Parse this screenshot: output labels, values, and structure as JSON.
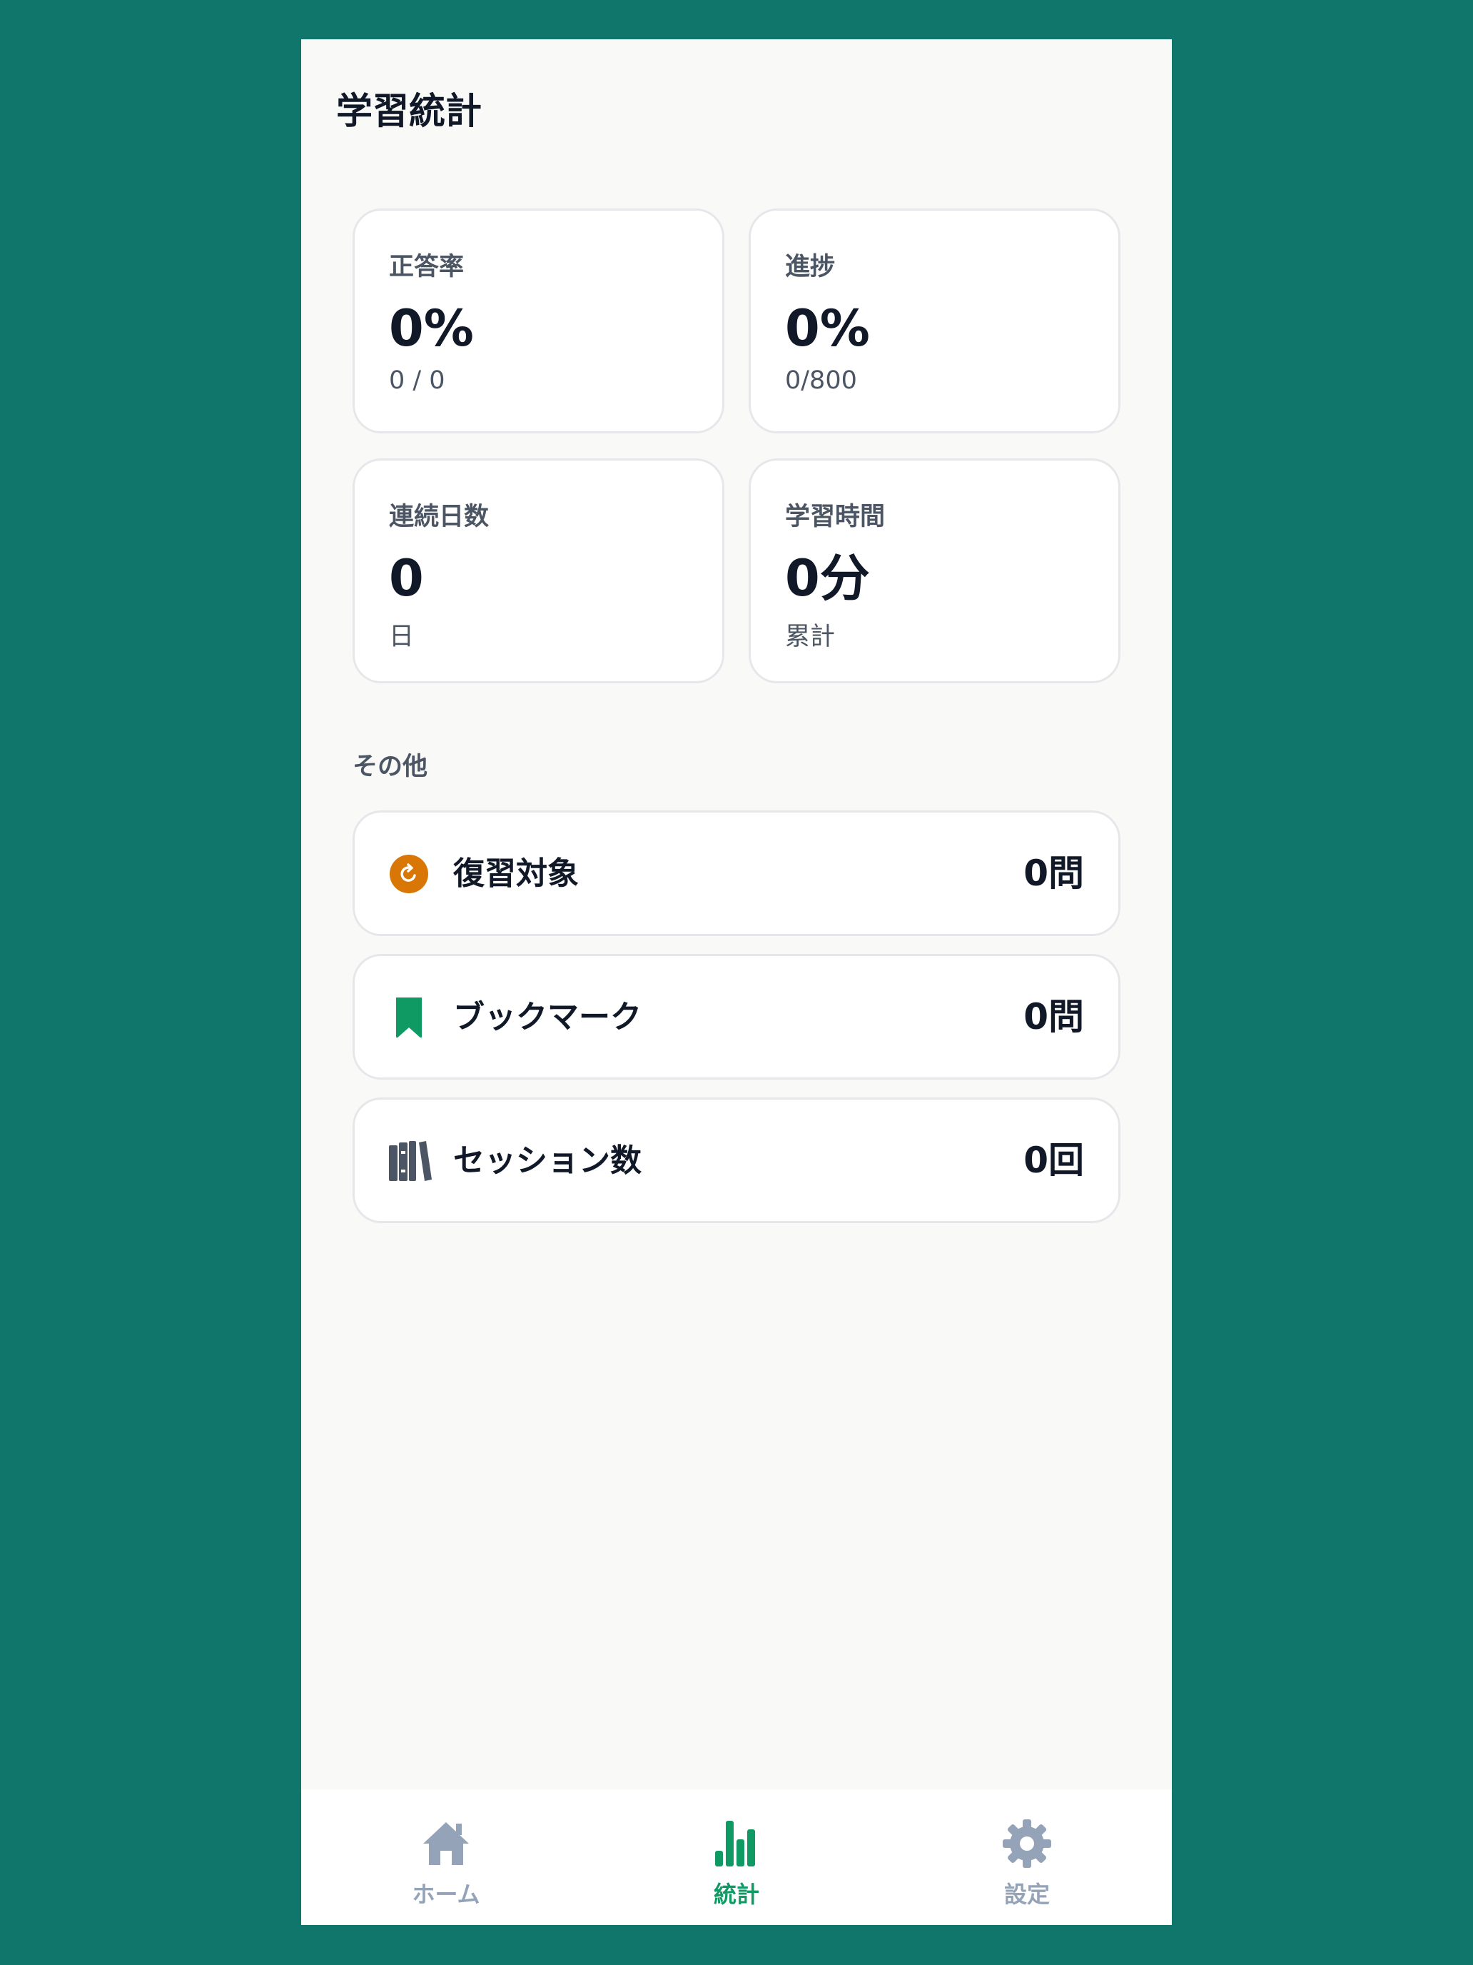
{
  "header": {
    "title": "学習統計"
  },
  "stats": [
    {
      "label": "正答率",
      "value": "0%",
      "sub": "0 / 0"
    },
    {
      "label": "進捗",
      "value": "0%",
      "sub": "0/800"
    },
    {
      "label": "連続日数",
      "value": "0",
      "sub": "日"
    },
    {
      "label": "学習時間",
      "value": "0分",
      "sub": "累計"
    }
  ],
  "other": {
    "title": "その他",
    "items": [
      {
        "label": "復習対象",
        "value": "0問",
        "icon": "refresh-icon"
      },
      {
        "label": "ブックマーク",
        "value": "0問",
        "icon": "bookmark-icon"
      },
      {
        "label": "セッション数",
        "value": "0回",
        "icon": "books-icon"
      }
    ]
  },
  "tabs": [
    {
      "label": "ホーム",
      "icon": "home-icon",
      "active": false
    },
    {
      "label": "統計",
      "icon": "bar-chart-icon",
      "active": true
    },
    {
      "label": "設定",
      "icon": "gear-icon",
      "active": false
    }
  ],
  "colors": {
    "background": "#10766c",
    "accent": "#0e9a62",
    "review": "#d97706",
    "inactive": "#94a3b8",
    "text": "#111827",
    "muted": "#4b5563"
  }
}
